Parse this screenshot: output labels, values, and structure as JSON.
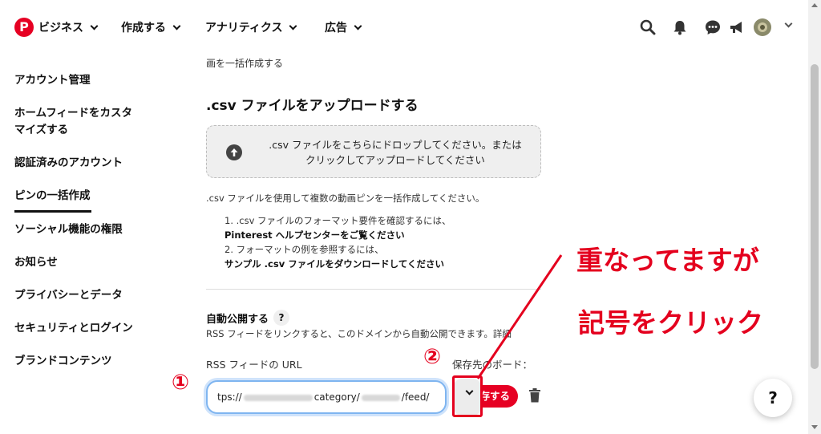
{
  "nav": {
    "logo_letter": "P",
    "business": "ビジネス",
    "create": "作成する",
    "analytics": "アナリティクス",
    "ads": "広告"
  },
  "sidebar": {
    "items": [
      {
        "label": "アカウント管理"
      },
      {
        "label": "ホームフィードをカスタ"
      },
      {
        "label": "マイズする"
      },
      {
        "label": "認証済みのアカウント"
      },
      {
        "label": "ピンの一括作成"
      },
      {
        "label": "ソーシャル機能の権限"
      },
      {
        "label": "お知らせ"
      },
      {
        "label": "プライバシーとデータ"
      },
      {
        "label": "セキュリティとログイン"
      },
      {
        "label": "ブランドコンテンツ"
      }
    ]
  },
  "main": {
    "breadcrumb": "画を一括作成する",
    "upload_title": ".csv ファイルをアップロードする",
    "dropzone_line1": ".csv ファイルをこちらにドロップしてください。または",
    "dropzone_line2": "クリックしてアップロードしてください",
    "desc": ".csv ファイルを使用して複数の動画ピンを一括作成してください。",
    "step1_a": "1. .csv ファイルのフォーマット要件を確認するには、",
    "step1_link": "Pinterest ヘルプセンターをご覧ください",
    "step2_a": "2. フォーマットの例を参照するには、",
    "step2_link": "サンプル .csv ファイルをダウンロードしてください",
    "auto_title": "自動公開する",
    "auto_help": "?",
    "auto_desc": "RSS フィードをリンクすると、このドメインから自動公開できます。詳細",
    "rss_label": "RSS フィードの URL",
    "board_label": "保存先のボード：",
    "rss_prefix": "tps://",
    "rss_mid": "category/",
    "rss_suffix": "/feed/",
    "save_btn": "保存する",
    "help_fab": "?"
  },
  "annotations": {
    "num1": "①",
    "num2": "②",
    "text1": "重なってますが",
    "text2": "記号をクリック"
  },
  "colors": {
    "brand": "#e60023",
    "annotation": "#e4001e",
    "focus_ring": "#7fb5f0"
  }
}
